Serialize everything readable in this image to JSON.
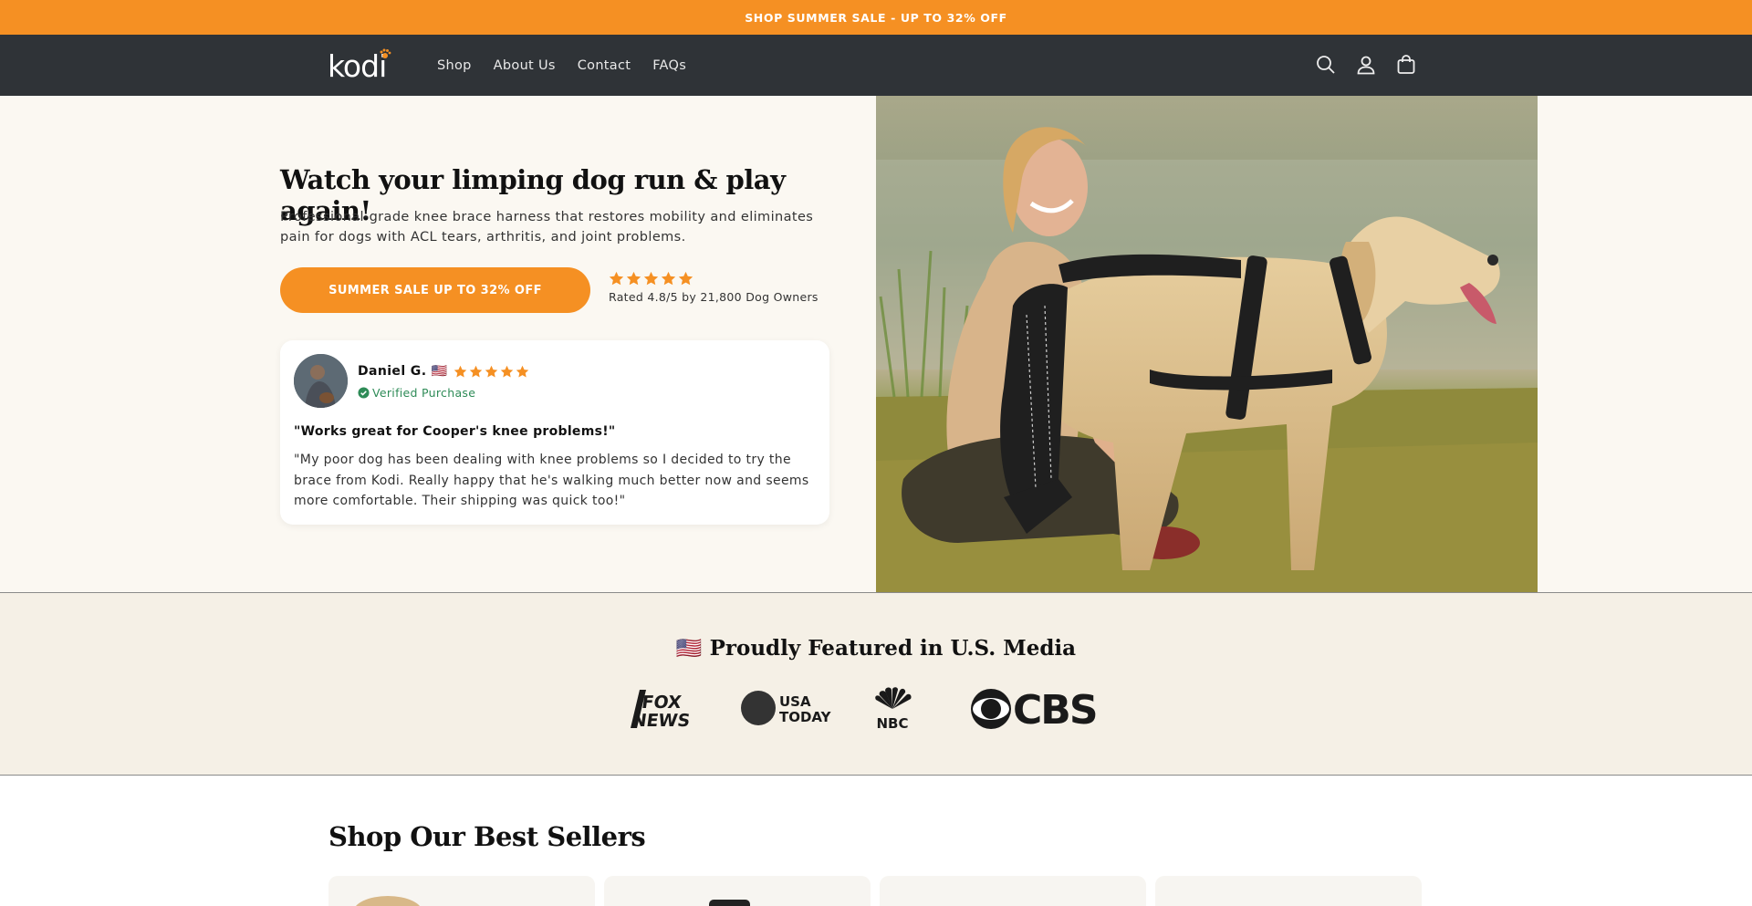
{
  "announcement": {
    "text": "SHOP SUMMER SALE - UP TO 32% OFF"
  },
  "header": {
    "logo_text": "kodi",
    "nav": [
      "Shop",
      "About Us",
      "Contact",
      "FAQs"
    ],
    "icons": [
      "search-icon",
      "account-icon",
      "cart-icon"
    ]
  },
  "hero": {
    "title": "Watch your limping dog run & play again!",
    "subtitle": "Professional-grade knee brace harness that restores mobility and eliminates pain for dogs with ACL tears, arthritis, and joint problems.",
    "cta_label": "SUMMER SALE UP TO 32% OFF",
    "rating_stars": 5,
    "rating_text": "Rated 4.8/5 by 21,800 Dog Owners",
    "review": {
      "name": "Daniel G. 🇺🇸",
      "stars": 5,
      "verified": "Verified Purchase",
      "title": "\"Works great for Cooper's knee problems!\"",
      "body": "\"My poor dog has been dealing with knee problems so I decided to try the brace from Kodi. Really happy that he's walking much better now and seems more comfortable. Their shipping was quick too!\""
    }
  },
  "featured": {
    "title": "🇺🇸 Proudly Featured in U.S. Media",
    "logos": [
      "FOX NEWS",
      "USA TODAY",
      "NBC",
      "CBS"
    ]
  },
  "best_sellers": {
    "title": "Shop Our Best Sellers"
  },
  "colors": {
    "accent": "#f59023",
    "header_bg": "#2f3337",
    "hero_bg": "#fbf8f2",
    "featured_bg": "#f5f0e6",
    "verified": "#2e8b57"
  }
}
